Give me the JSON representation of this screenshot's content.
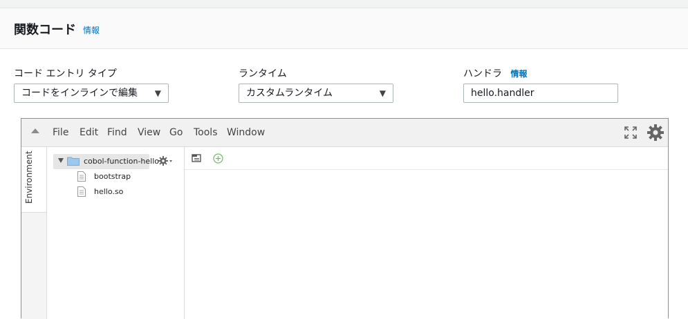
{
  "section": {
    "title": "関数コード",
    "info": "情報"
  },
  "fields": {
    "code_entry": {
      "label": "コード エントリ タイプ",
      "value": "コードをインラインで編集"
    },
    "runtime": {
      "label": "ランタイム",
      "value": "カスタムランタイム"
    },
    "handler": {
      "label": "ハンドラ",
      "info": "情報",
      "value": "hello.handler"
    }
  },
  "ide": {
    "menu": [
      "File",
      "Edit",
      "Find",
      "View",
      "Go",
      "Tools",
      "Window"
    ],
    "env_tab": "Environment",
    "tree": {
      "root": "cobol-function-hello",
      "files": [
        "bootstrap",
        "hello.so"
      ]
    },
    "icons": {
      "fullscreen": "fullscreen-icon",
      "settings": "gear-icon",
      "folder": "folder-icon",
      "file": "file-icon",
      "tabs": "tabs-list-icon",
      "new_tab": "plus-circle-icon"
    },
    "colors": {
      "link": "#0073bb",
      "folder": "#9cc7ef",
      "new_tab": "#6cbf5e"
    }
  }
}
